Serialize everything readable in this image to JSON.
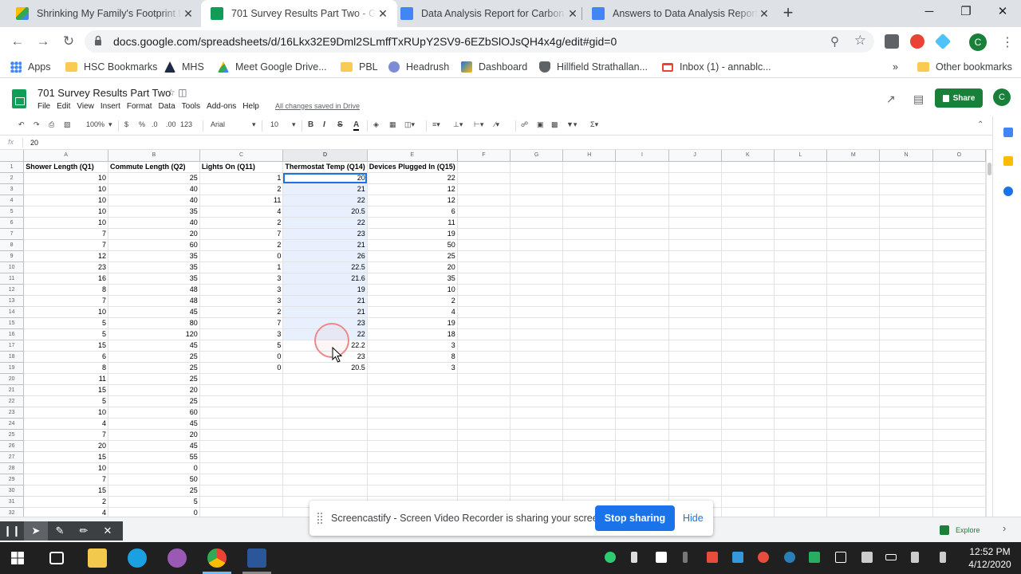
{
  "browser": {
    "tabs": [
      {
        "title": "Shrinking My Family's Footprint I",
        "icon": "drive-icon",
        "active": false
      },
      {
        "title": "701 Survey Results Part Two - Go",
        "icon": "sheets-icon",
        "active": true
      },
      {
        "title": "Data Analysis Report for Carbon I",
        "icon": "docs-icon",
        "active": false
      },
      {
        "title": "Answers to Data Analysis Report",
        "icon": "docs-icon",
        "active": false
      }
    ],
    "tab_close": "✕",
    "new_tab": "+",
    "window_controls": {
      "minimize": "─",
      "restore": "❐",
      "close": "✕"
    },
    "url": "docs.google.com/spreadsheets/d/16Lkx32E9Dml2SLmffTxRUpY2SV9-6EZbSlOJsQH4x4g/edit#gid=0",
    "profile_initial": "C",
    "bookmarks": [
      {
        "label": "Apps",
        "icon": "apps-icon"
      },
      {
        "label": "HSC Bookmarks",
        "icon": "folder-icon"
      },
      {
        "label": "MHS",
        "icon": "mhs-icon"
      },
      {
        "label": "Meet Google Drive...",
        "icon": "drive-icon"
      },
      {
        "label": "PBL",
        "icon": "folder-icon"
      },
      {
        "label": "Headrush",
        "icon": "headrush-icon"
      },
      {
        "label": "Dashboard",
        "icon": "dashboard-icon"
      },
      {
        "label": "Hillfield Strathallan...",
        "icon": "hillfield-icon"
      },
      {
        "label": "Inbox (1) - annablc...",
        "icon": "gmail-icon"
      }
    ],
    "bookmarks_overflow": "»",
    "other_bookmarks": "Other bookmarks"
  },
  "sheet": {
    "title": "701 Survey Results Part Two",
    "menus": [
      "File",
      "Edit",
      "View",
      "Insert",
      "Format",
      "Data",
      "Tools",
      "Add-ons",
      "Help"
    ],
    "save_status": "All changes saved in Drive",
    "share_label": "Share",
    "account_initial": "C",
    "toolbar": {
      "zoom": "100%",
      "currency": "$",
      "percent": "%",
      "dec_less": ".0",
      "dec_more": ".00",
      "format_more": "123",
      "font": "Arial",
      "font_size": "10",
      "bold": "B",
      "italic": "I",
      "strike": "S",
      "text_color": "A"
    },
    "formula_label": "fx",
    "formula_value": "20",
    "columns": [
      "A",
      "B",
      "C",
      "D",
      "E",
      "F",
      "G",
      "H",
      "I",
      "J",
      "K",
      "L",
      "M",
      "N",
      "O"
    ],
    "headers": [
      "Shower Length (Q1)",
      "Commute Length (Q2)",
      "Lights On (Q11)",
      "Thermostat Temp (Q14)",
      "Devices Plugged In (Q15)"
    ],
    "rows": [
      [
        "10",
        "25",
        "1",
        "20",
        "22"
      ],
      [
        "10",
        "40",
        "2",
        "21",
        "12"
      ],
      [
        "10",
        "40",
        "11",
        "22",
        "12"
      ],
      [
        "10",
        "35",
        "4",
        "20.5",
        "6"
      ],
      [
        "10",
        "40",
        "2",
        "22",
        "11"
      ],
      [
        "7",
        "20",
        "7",
        "23",
        "19"
      ],
      [
        "7",
        "60",
        "2",
        "21",
        "50"
      ],
      [
        "12",
        "35",
        "0",
        "26",
        "25"
      ],
      [
        "23",
        "35",
        "1",
        "22.5",
        "20"
      ],
      [
        "16",
        "35",
        "3",
        "21.6",
        "35"
      ],
      [
        "8",
        "48",
        "3",
        "19",
        "10"
      ],
      [
        "7",
        "48",
        "3",
        "21",
        "2"
      ],
      [
        "10",
        "45",
        "2",
        "21",
        "4"
      ],
      [
        "5",
        "80",
        "7",
        "23",
        "19"
      ],
      [
        "5",
        "120",
        "3",
        "22",
        "18"
      ],
      [
        "15",
        "45",
        "5",
        "22.2",
        "3"
      ],
      [
        "6",
        "25",
        "0",
        "23",
        "8"
      ],
      [
        "8",
        "25",
        "0",
        "20.5",
        "3"
      ],
      [
        "11",
        "25",
        "",
        "",
        ""
      ],
      [
        "15",
        "20",
        "",
        "",
        ""
      ],
      [
        "5",
        "25",
        "",
        "",
        ""
      ],
      [
        "10",
        "60",
        "",
        "",
        ""
      ],
      [
        "4",
        "45",
        "",
        "",
        ""
      ],
      [
        "7",
        "20",
        "",
        "",
        ""
      ],
      [
        "20",
        "45",
        "",
        "",
        ""
      ],
      [
        "15",
        "55",
        "",
        "",
        ""
      ],
      [
        "10",
        "0",
        "",
        "",
        ""
      ],
      [
        "7",
        "50",
        "",
        "",
        ""
      ],
      [
        "15",
        "25",
        "",
        "",
        ""
      ],
      [
        "2",
        "5",
        "",
        "",
        ""
      ],
      [
        "4",
        "0",
        "",
        "",
        ""
      ]
    ],
    "explore_label": "Explore"
  },
  "screencastify": {
    "message": "Screencastify - Screen Video Recorder is sharing your screen.",
    "stop_label": "Stop sharing",
    "hide_label": "Hide"
  },
  "taskbar": {
    "time": "12:52 PM",
    "date": "4/12/2020"
  },
  "colors": {
    "sheets_green": "#188038",
    "selection_blue": "#1a73e8",
    "selection_fill": "#e8f0fe"
  }
}
